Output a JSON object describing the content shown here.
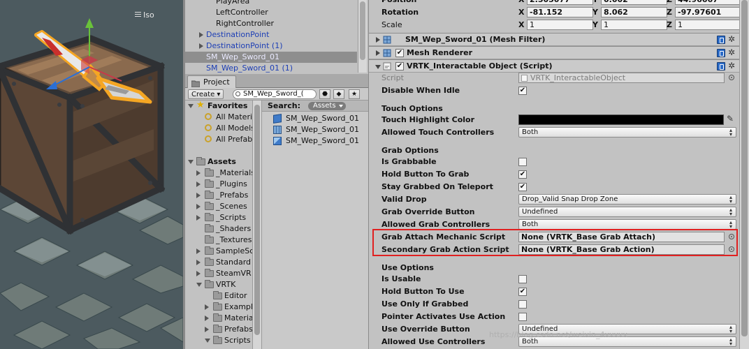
{
  "scene": {
    "view_mode": "Iso"
  },
  "hierarchy": {
    "items": [
      {
        "text": "PlayArea",
        "style": "plain",
        "arrow": false,
        "selected": false
      },
      {
        "text": "LeftController",
        "style": "plain",
        "arrow": false,
        "selected": false
      },
      {
        "text": "RightController",
        "style": "plain",
        "arrow": false,
        "selected": false
      },
      {
        "text": "DestinationPoint",
        "style": "blue",
        "arrow": true,
        "selected": false
      },
      {
        "text": "DestinationPoint (1)",
        "style": "blue",
        "arrow": true,
        "selected": false
      },
      {
        "text": "SM_Wep_Sword_01",
        "style": "blue",
        "arrow": false,
        "selected": true
      },
      {
        "text": "SM_Wep_Sword_01 (1)",
        "style": "blue",
        "arrow": false,
        "selected": false
      }
    ]
  },
  "project": {
    "tab_label": "Project",
    "create_label": "Create",
    "search_value": "SM_Wep_Sword_(",
    "tree": [
      {
        "text": "Favorites",
        "indent": 0,
        "icon": "star",
        "arrow": "down",
        "bold": true
      },
      {
        "text": "All Materials",
        "indent": 1,
        "icon": "magnifier",
        "arrow": "",
        "bold": false
      },
      {
        "text": "All Models",
        "indent": 1,
        "icon": "magnifier",
        "arrow": "",
        "bold": false
      },
      {
        "text": "All Prefabs",
        "indent": 1,
        "icon": "magnifier",
        "arrow": "",
        "bold": false
      },
      {
        "text": "",
        "indent": 0,
        "icon": "",
        "arrow": "",
        "bold": false
      },
      {
        "text": "Assets",
        "indent": 0,
        "icon": "folder",
        "arrow": "down",
        "bold": true
      },
      {
        "text": "_Materials",
        "indent": 1,
        "icon": "folder",
        "arrow": "right",
        "bold": false
      },
      {
        "text": "_Plugins",
        "indent": 1,
        "icon": "folder",
        "arrow": "right",
        "bold": false
      },
      {
        "text": "_Prefabs",
        "indent": 1,
        "icon": "folder",
        "arrow": "right",
        "bold": false
      },
      {
        "text": "_Scenes",
        "indent": 1,
        "icon": "folder",
        "arrow": "right",
        "bold": false
      },
      {
        "text": "_Scripts",
        "indent": 1,
        "icon": "folder",
        "arrow": "right",
        "bold": false
      },
      {
        "text": "_Shaders",
        "indent": 1,
        "icon": "folder",
        "arrow": "",
        "bold": false
      },
      {
        "text": "_Textures",
        "indent": 1,
        "icon": "folder",
        "arrow": "",
        "bold": false
      },
      {
        "text": "SampleScenes",
        "indent": 1,
        "icon": "folder",
        "arrow": "right",
        "bold": false
      },
      {
        "text": "Standard Assets",
        "indent": 1,
        "icon": "folder",
        "arrow": "right",
        "bold": false
      },
      {
        "text": "SteamVR",
        "indent": 1,
        "icon": "folder",
        "arrow": "right",
        "bold": false
      },
      {
        "text": "VRTK",
        "indent": 1,
        "icon": "folder",
        "arrow": "down",
        "bold": false
      },
      {
        "text": "Editor",
        "indent": 2,
        "icon": "folder",
        "arrow": "",
        "bold": false
      },
      {
        "text": "Examples",
        "indent": 2,
        "icon": "folder",
        "arrow": "right",
        "bold": false
      },
      {
        "text": "Materials",
        "indent": 2,
        "icon": "folder",
        "arrow": "right",
        "bold": false
      },
      {
        "text": "Prefabs",
        "indent": 2,
        "icon": "folder",
        "arrow": "right",
        "bold": false
      },
      {
        "text": "Scripts",
        "indent": 2,
        "icon": "folder",
        "arrow": "down",
        "bold": false
      }
    ],
    "search_label": "Search:",
    "search_scope": "Assets",
    "results": [
      {
        "text": "SM_Wep_Sword_01",
        "icon": "cube"
      },
      {
        "text": "SM_Wep_Sword_01",
        "icon": "mesh"
      },
      {
        "text": "SM_Wep_Sword_01",
        "icon": "prefab"
      }
    ]
  },
  "inspector": {
    "transform": [
      {
        "label": "Position",
        "bold": true,
        "x": "2.505077",
        "y": "0.002",
        "z": "44.96667"
      },
      {
        "label": "Rotation",
        "bold": true,
        "x": "-81.152",
        "y": "8.062",
        "z": "-97.97601"
      },
      {
        "label": "Scale",
        "bold": false,
        "x": "1",
        "y": "1",
        "z": "1"
      }
    ],
    "components": [
      {
        "title": "SM_Wep_Sword_01 (Mesh Filter)",
        "has_check": false,
        "expanded": false
      },
      {
        "title": "Mesh Renderer",
        "has_check": true,
        "expanded": false
      },
      {
        "title": "VRTK_Interactable Object (Script)",
        "has_check": true,
        "expanded": true
      }
    ],
    "script_label": "Script",
    "script_value": "VRTK_InteractableObject",
    "disable_when_idle": "Disable When Idle",
    "touch_options": "Touch Options",
    "touch_highlight_color": "Touch Highlight Color",
    "allowed_touch_controllers": "Allowed Touch Controllers",
    "allowed_touch_value": "Both",
    "grab_options": "Grab Options",
    "is_grabbable": "Is Grabbable",
    "hold_button_to_grab": "Hold Button To Grab",
    "stay_grabbed_on_teleport": "Stay Grabbed On Teleport",
    "valid_drop": "Valid Drop",
    "valid_drop_value": "Drop_Valid Snap Drop Zone",
    "grab_override_button": "Grab Override Button",
    "grab_override_value": "Undefined",
    "allowed_grab_controllers": "Allowed Grab Controllers",
    "allowed_grab_value": "Both",
    "grab_attach_mechanic_script": "Grab Attach Mechanic Script",
    "grab_attach_value": "None (VRTK_Base Grab Attach)",
    "secondary_grab_action_script": "Secondary Grab Action Script",
    "secondary_grab_value": "None (VRTK_Base Grab Action)",
    "use_options": "Use Options",
    "is_usable": "Is Usable",
    "hold_button_to_use": "Hold Button To Use",
    "use_only_if_grabbed": "Use Only If Grabbed",
    "pointer_activates_use_action": "Pointer Activates Use Action",
    "use_override_button": "Use Override Button",
    "use_override_value": "Undefined",
    "allowed_use_controllers": "Allowed Use Controllers",
    "allowed_use_value": "Both"
  },
  "watermark": "https://blog.csdn.net/weixin_4xxxxx",
  "colors": {
    "selection_red": "#e02020",
    "link_blue": "#1c3eb5",
    "sword_outline": "#f5a623"
  }
}
